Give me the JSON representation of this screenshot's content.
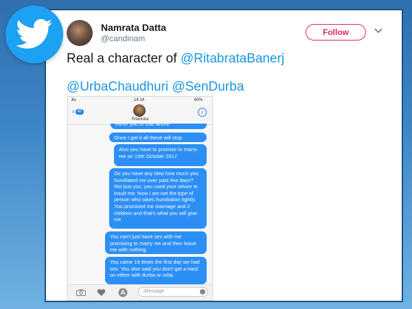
{
  "tweet": {
    "display_name": "Namrata Datta",
    "handle": "@candinam",
    "follow_label": "Follow",
    "text_prefix": "Real a character of ",
    "mentions_line1": "@RitabrataBanerj",
    "mentions_line2": [
      "@UrbaChaudhuri",
      "@SenDurba"
    ]
  },
  "phone": {
    "carrier": "Jio",
    "time": "14:14",
    "battery": "60%",
    "back_count": "40",
    "contact_name": "Ritabrata",
    "composer_placeholder": "iMessage",
    "messages": [
      "either you or that whore",
      "Once I get it all these will stop",
      "Also you have to promise to marry me on 15th October 2017",
      "Do you have any idea how much you humiliated me over past few days? Not just you, you used your whore to insult me. Now I am not the type of person who takes humiliation lightly. You promised me marriage and 2 children and that's what you will give me",
      "You can't just have sex with me promising to marry me and then leave me with nothing.",
      "You came 19 times the first day we had sex. You also said you don't get a hard on either with durba or urba."
    ]
  },
  "icons": [
    "twitter-bird-icon",
    "chevron-down-icon",
    "back-chevron-icon",
    "info-icon",
    "camera-icon",
    "heart-icon",
    "app-store-icon",
    "mic-icon"
  ],
  "colors": {
    "twitter_blue": "#1da1f2",
    "mention": "#1b95e0",
    "follow": "#e0245e",
    "bubble": "#2c8ff5"
  }
}
